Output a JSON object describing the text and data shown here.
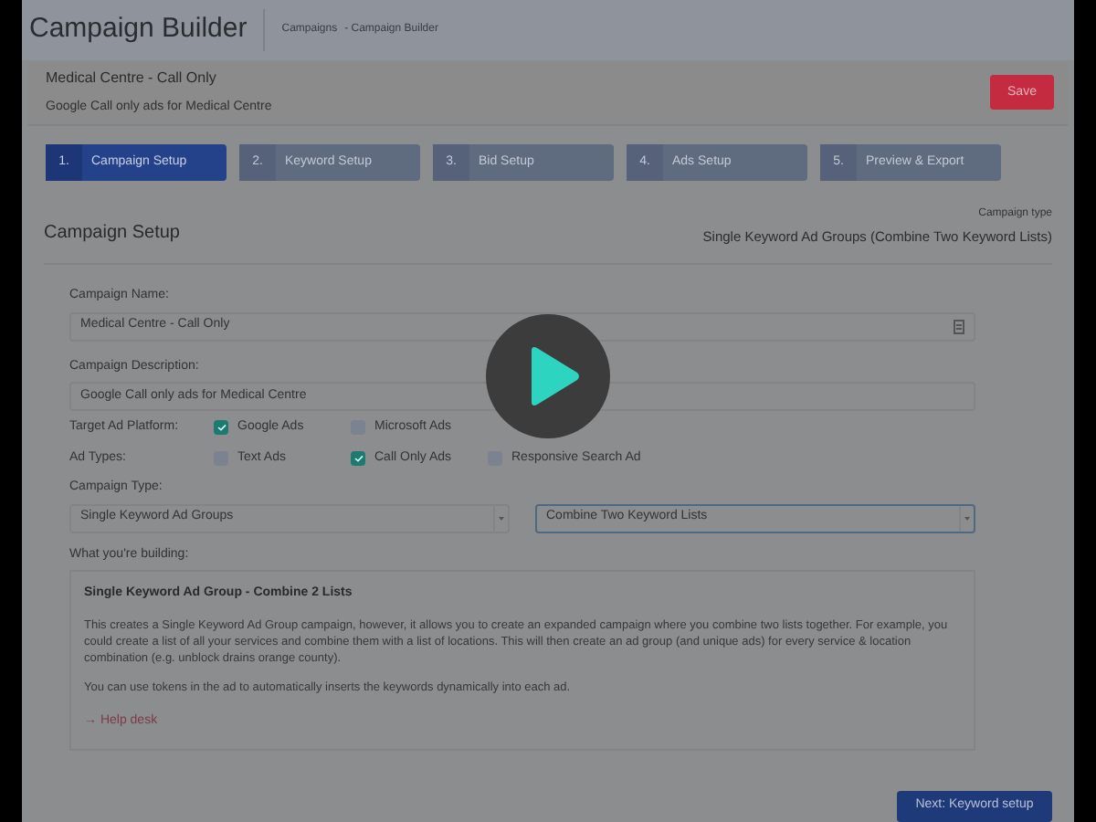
{
  "header": {
    "title": "Campaign Builder",
    "breadcrumbs": [
      "Campaigns",
      "- Campaign Builder"
    ]
  },
  "campaign": {
    "name": "Medical Centre - Call Only",
    "description": "Google Call only ads for Medical Centre",
    "save": "Save"
  },
  "steps": [
    {
      "number": "1.",
      "label": "Campaign Setup",
      "selected": true
    },
    {
      "number": "2.",
      "label": "Keyword Setup",
      "selected": false
    },
    {
      "number": "3.",
      "label": "Bid Setup",
      "selected": false
    },
    {
      "number": "4.",
      "label": "Ads Setup",
      "selected": false
    },
    {
      "number": "5.",
      "label": "Preview & Export",
      "selected": false
    }
  ],
  "section": {
    "title": "Campaign Setup",
    "type_label": "Campaign type",
    "type_value": "Single Keyword Ad Groups (Combine Two Keyword Lists)"
  },
  "form": {
    "name_label": "Campaign Name:",
    "name_value": "Medical Centre - Call Only",
    "description_label": "Campaign Description:",
    "description_value": "Google Call only ads for Medical Centre",
    "option_rows": [
      {
        "label": "Target Ad Platform:",
        "options": [
          {
            "label": "Google Ads",
            "checked": true
          },
          {
            "label": "Microsoft Ads",
            "checked": false
          }
        ]
      },
      {
        "label": "Ad Types:",
        "options": [
          {
            "label": "Text Ads",
            "checked": false
          },
          {
            "label": "Call Only Ads",
            "checked": true
          },
          {
            "label": "Responsive Search Ad",
            "checked": false
          }
        ]
      }
    ],
    "type_label": "Campaign Type:",
    "selects": [
      {
        "value": "Single Keyword Ad Groups",
        "focused": false
      },
      {
        "value": "Combine Two Keyword Lists",
        "focused": true
      }
    ]
  },
  "building": {
    "label": "What you're building:",
    "title": "Single Keyword Ad Group - Combine 2 Lists",
    "paragraphs": [
      "This creates a Single Keyword Ad Group campaign, however, it allows you to create an expanded campaign where you combine two lists together. For example, you could create a list of all your services and combine them with a list of locations. This will then create an ad group (and unique ads) for every service & location combination (e.g. unblock drains orange county).",
      "You can use tokens in the ad to automatically inserts the keywords dynamically into each ad."
    ],
    "link": "→ Help desk"
  },
  "next": "Next: Keyword setup"
}
